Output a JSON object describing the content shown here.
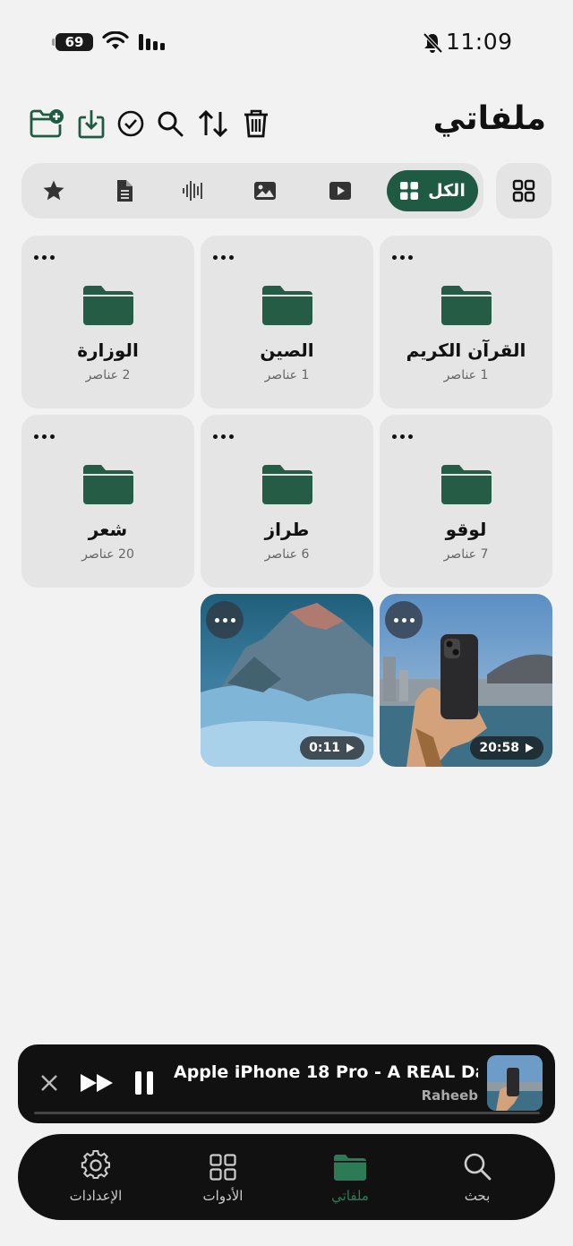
{
  "status_bar": {
    "battery": "69",
    "time": "11:09"
  },
  "header": {
    "title": "ملفاتي"
  },
  "toolbar": [
    "new-folder",
    "import",
    "select",
    "search",
    "sort",
    "delete"
  ],
  "filters": {
    "all_label": "الكل"
  },
  "folders": [
    {
      "name": "القرآن الكريم",
      "count": "1 عناصر"
    },
    {
      "name": "الصين",
      "count": "1 عناصر"
    },
    {
      "name": "الوزارة",
      "count": "2 عناصر"
    },
    {
      "name": "لوقو",
      "count": "7 عناصر"
    },
    {
      "name": "طراز",
      "count": "6 عناصر"
    },
    {
      "name": "شعر",
      "count": "20 عناصر"
    }
  ],
  "videos": [
    {
      "duration": "20:58"
    },
    {
      "duration": "0:11"
    }
  ],
  "player": {
    "title": "Apple iPhone 18 Pro - A REAL Da...",
    "artist": "Raheeb",
    "progress": 0
  },
  "tabs": [
    {
      "label": "بحث"
    },
    {
      "label": "ملفاتي"
    },
    {
      "label": "الأدوات"
    },
    {
      "label": "الإعدادات"
    }
  ],
  "colors": {
    "accent": "#1f5b42",
    "background": "#f2f2f2",
    "card": "#e5e5e5",
    "bar": "#111111"
  }
}
